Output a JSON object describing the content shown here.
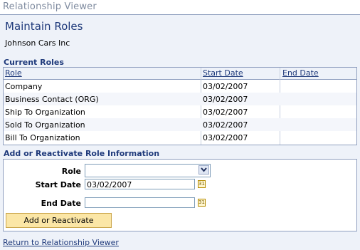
{
  "app": {
    "title": "Relationship Viewer"
  },
  "page": {
    "title": "Maintain Roles",
    "org_name": "Johnson Cars Inc"
  },
  "current_roles": {
    "heading": "Current Roles",
    "columns": [
      "Role",
      "Start Date",
      "End Date"
    ],
    "rows": [
      {
        "role": "Company",
        "start": "03/02/2007",
        "end": ""
      },
      {
        "role": "Business Contact (ORG)",
        "start": "03/02/2007",
        "end": ""
      },
      {
        "role": "Ship To Organization",
        "start": "03/02/2007",
        "end": ""
      },
      {
        "role": "Sold To Organization",
        "start": "03/02/2007",
        "end": ""
      },
      {
        "role": "Bill To Organization",
        "start": "03/02/2007",
        "end": ""
      }
    ]
  },
  "add_section": {
    "heading": "Add or Reactivate Role Information",
    "role_label": "Role",
    "role_value": "",
    "start_label": "Start Date",
    "start_value": "03/02/2007",
    "end_label": "End Date",
    "end_value": "",
    "button_label": "Add or Reactivate"
  },
  "footer": {
    "return_link": "Return to Relationship Viewer"
  },
  "colors": {
    "heading_blue": "#1f3a7b",
    "button_bg": "#fbe6a6",
    "panel_bg": "#eef2f9"
  }
}
